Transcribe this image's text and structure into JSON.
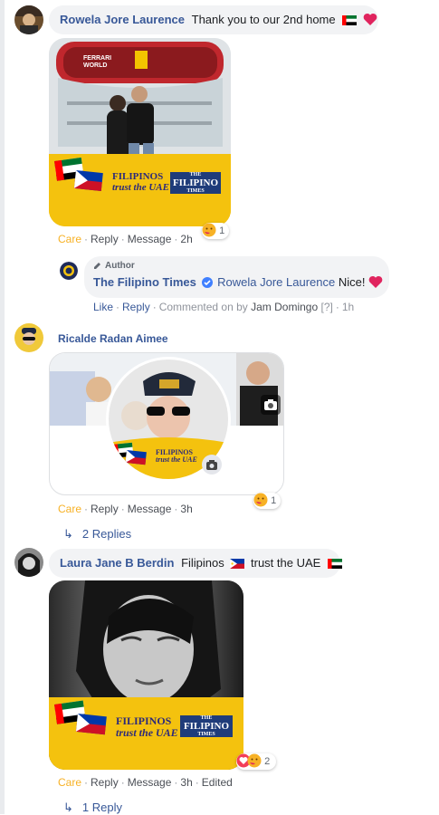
{
  "comments": [
    {
      "author": "Rowela Jore Laurence",
      "text": "Thank you to our 2nd home",
      "actions": {
        "care": "Care",
        "reply": "Reply",
        "message": "Message",
        "time": "2h"
      },
      "reaction_count": "1",
      "image": {
        "line1": "FILIPINOS",
        "line2": "trust the UAE",
        "brand": "FILIPINO",
        "brand_small": "THE",
        "brand_small2": "TIMES",
        "sign": "FERRARI WORLD"
      }
    },
    {
      "author": "Ricalde Radan Aimee",
      "actions": {
        "care": "Care",
        "reply": "Reply",
        "message": "Message",
        "time": "3h"
      },
      "reaction_count": "1",
      "image": {
        "line1": "FILIPINOS",
        "line2": "trust the UAE"
      },
      "replies": "2 Replies"
    },
    {
      "author": "Laura Jane B Berdin",
      "text_part1": "Filipinos",
      "text_part2": "trust the UAE",
      "actions": {
        "care": "Care",
        "reply": "Reply",
        "message": "Message",
        "time": "3h",
        "edited": "Edited"
      },
      "reaction_count": "2",
      "image": {
        "line1": "FILIPINOS",
        "line2": "trust the UAE",
        "brand": "FILIPINO",
        "brand_small": "THE",
        "brand_small2": "TIMES"
      },
      "replies": "1 Reply"
    }
  ],
  "reply": {
    "badge": "Author",
    "author": "The Filipino Times",
    "mention": "Rowela Jore Laurence",
    "text": "Nice!",
    "actions": {
      "like": "Like",
      "reply": "Reply",
      "commented_on": "Commented on by",
      "by_name": "Jam Domingo",
      "q": "[?]",
      "time": "1h"
    }
  },
  "colors": {
    "link": "#385898",
    "care": "#f7b125",
    "banner": "#f4c20e",
    "heart": "#e0245e"
  }
}
